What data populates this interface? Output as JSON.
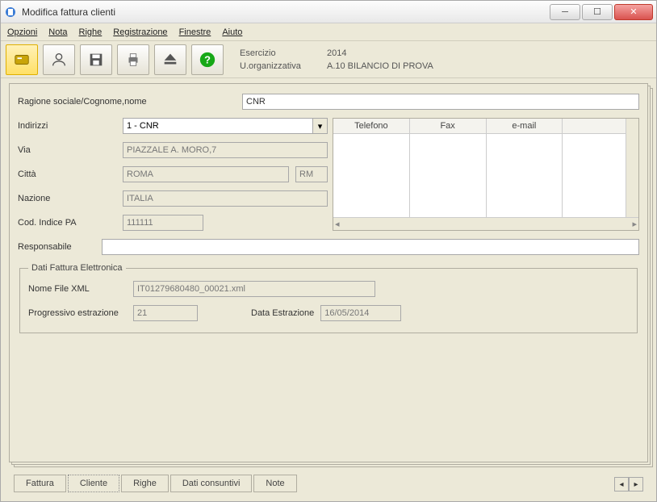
{
  "window": {
    "title": "Modifica fattura clienti"
  },
  "menu": {
    "opzioni": "Opzioni",
    "nota": "Nota",
    "righe": "Righe",
    "registrazione": "Registrazione",
    "finestre": "Finestre",
    "aiuto": "Aiuto"
  },
  "header": {
    "esercizio_label": "Esercizio",
    "esercizio": "2014",
    "uo_label": "U.organizzativa",
    "uo": "A.10 BILANCIO DI PROVA"
  },
  "labels": {
    "ragione_sociale": "Ragione sociale/Cognome,nome",
    "indirizzi": "Indirizzi",
    "via": "Via",
    "citta": "Città",
    "nazione": "Nazione",
    "cod_indice_pa": "Cod. Indice PA",
    "responsabile": "Responsabile",
    "nome_file_xml": "Nome File XML",
    "progressivo_estrazione": "Progressivo estrazione",
    "data_estrazione": "Data Estrazione",
    "fieldset_efatt": "Dati Fattura Elettronica"
  },
  "values": {
    "ragione_sociale": "CNR",
    "indirizzo_sel": "1 - CNR",
    "via": "PIAZZALE A. MORO,7",
    "citta": "ROMA",
    "prov": "RM",
    "nazione": "ITALIA",
    "cod_indice_pa": "111111",
    "responsabile": "",
    "nome_file_xml": "IT01279680480_00021.xml",
    "progressivo": "21",
    "data_estrazione": "16/05/2014"
  },
  "contact_grid": {
    "headers": [
      "Telefono",
      "Fax",
      "e-mail",
      ""
    ]
  },
  "tabs": {
    "fattura": "Fattura",
    "cliente": "Cliente",
    "righe": "Righe",
    "dati_consuntivi": "Dati consuntivi",
    "note": "Note"
  }
}
